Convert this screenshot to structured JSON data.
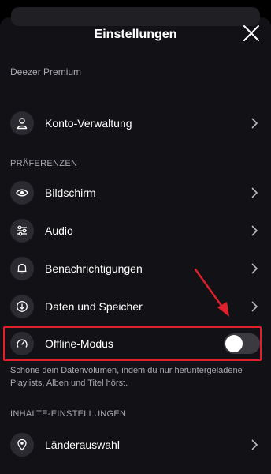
{
  "header": {
    "title": "Einstellungen"
  },
  "premium": {
    "label": "Deezer Premium"
  },
  "account": {
    "label": "Konto-Verwaltung"
  },
  "preferences": {
    "heading": "PRÄFERENZEN",
    "items": [
      {
        "label": "Bildschirm",
        "icon": "eye-icon"
      },
      {
        "label": "Audio",
        "icon": "sliders-icon"
      },
      {
        "label": "Benachrichtigungen",
        "icon": "bell-icon"
      },
      {
        "label": "Daten und Speicher",
        "icon": "download-icon"
      }
    ]
  },
  "offline": {
    "label": "Offline-Modus",
    "icon": "speedometer-icon",
    "enabled": false,
    "description": "Schone dein Datenvolumen, indem du nur heruntergeladene Playlists, Alben und Titel hörst."
  },
  "content": {
    "heading": "INHALTE-EINSTELLUNGEN",
    "items": [
      {
        "label": "Länderauswahl",
        "icon": "location-pin-icon"
      }
    ]
  },
  "colors": {
    "background": "#121216",
    "highlight": "#e0202a"
  }
}
